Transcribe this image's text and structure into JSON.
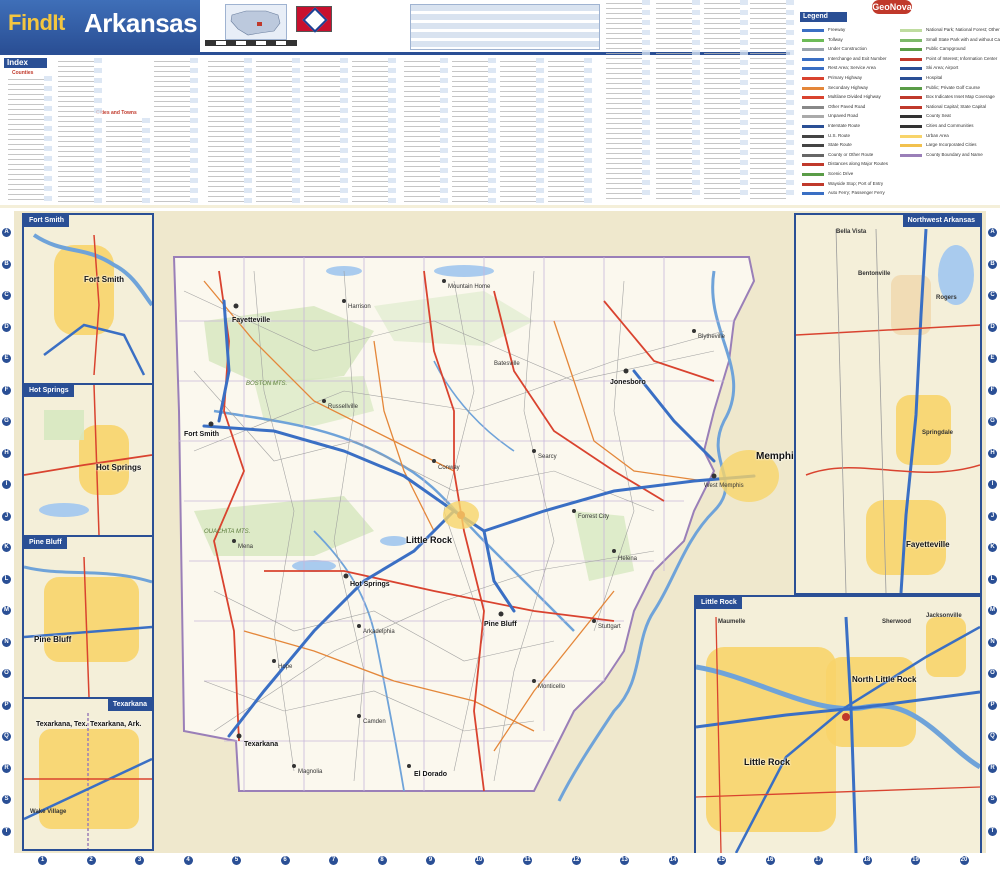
{
  "header": {
    "brand_prefix": "FindIt",
    "state_name": "Arkansas",
    "publisher": "GeoNova"
  },
  "index": {
    "label": "Index",
    "counties_label": "Counties",
    "cities_label": "Cities and Towns"
  },
  "legend": {
    "label": "Legend",
    "items": [
      {
        "label": "Freeway",
        "color": "#3a6fc4"
      },
      {
        "label": "Tollway",
        "color": "#6dbb58"
      },
      {
        "label": "Under Construction",
        "color": "#9aa3ad"
      },
      {
        "label": "Interchange and Exit Number",
        "color": "#3a6fc4"
      },
      {
        "label": "Rest Area; Service Area",
        "color": "#3a6fc4"
      },
      {
        "label": "Primary Highway",
        "color": "#d9432f"
      },
      {
        "label": "Secondary Highway",
        "color": "#e4873a"
      },
      {
        "label": "Multilane Divided Highway",
        "color": "#d9432f"
      },
      {
        "label": "Other Paved Road",
        "color": "#888888"
      },
      {
        "label": "Unpaved Road",
        "color": "#aaaaaa"
      },
      {
        "label": "Interstate Route",
        "color": "#2a4f95"
      },
      {
        "label": "U.S. Route",
        "color": "#444444"
      },
      {
        "label": "State Route",
        "color": "#444444"
      },
      {
        "label": "County or Other Route",
        "color": "#666666"
      },
      {
        "label": "Distances along Major Routes",
        "color": "#c0392b"
      },
      {
        "label": "Scenic Drive",
        "color": "#5a9c47"
      },
      {
        "label": "Wayside Stop; Port of Entry",
        "color": "#c0392b"
      },
      {
        "label": "Auto Ferry; Passenger Ferry",
        "color": "#3a6fc4"
      }
    ],
    "items_right": [
      {
        "label": "National Park; National Forest; Other Large Park",
        "color": "#bfdca0"
      },
      {
        "label": "Small State Park with and without Camping",
        "color": "#7cb96a"
      },
      {
        "label": "Public Campground",
        "color": "#5a9c47"
      },
      {
        "label": "Point of Interest; Information Center",
        "color": "#c0392b"
      },
      {
        "label": "Ski Area; Airport",
        "color": "#2a4f95"
      },
      {
        "label": "Hospital",
        "color": "#2a4f95"
      },
      {
        "label": "Public; Private Golf Course",
        "color": "#5a9c47"
      },
      {
        "label": "Box Indicates Inset Map Coverage",
        "color": "#c0392b"
      },
      {
        "label": "National Capital; State Capital",
        "color": "#c0392b"
      },
      {
        "label": "County Seat",
        "color": "#333333"
      },
      {
        "label": "Cities and Communities",
        "color": "#333333"
      },
      {
        "label": "Urban Area",
        "color": "#f8d46a"
      },
      {
        "label": "Large Incorporated Cities",
        "color": "#f2c14e"
      },
      {
        "label": "County Boundary and Name",
        "color": "#9a7fb8"
      }
    ]
  },
  "insets": {
    "fort_smith": {
      "title": "Fort Smith",
      "city": "Fort Smith"
    },
    "hot_springs": {
      "title": "Hot Springs",
      "city": "Hot Springs"
    },
    "pine_bluff": {
      "title": "Pine Bluff",
      "city": "Pine Bluff"
    },
    "texarkana": {
      "title": "Texarkana",
      "city_ar": "Texarkana, Ark.",
      "city_tx": "Texarkana, Tex.",
      "wake_village": "Wake Village"
    },
    "northwest": {
      "title": "Northwest Arkansas",
      "bella_vista": "Bella Vista",
      "bentonville": "Bentonville",
      "rogers": "Rogers",
      "springdale": "Springdale",
      "fayetteville": "Fayetteville"
    },
    "little_rock": {
      "title": "Little Rock",
      "city": "Little Rock",
      "north": "North Little Rock",
      "jacksonville": "Jacksonville",
      "sherwood": "Sherwood",
      "maumelle": "Maumelle"
    }
  },
  "map": {
    "cities": {
      "little_rock": "Little Rock",
      "fort_smith": "Fort Smith",
      "fayetteville": "Fayetteville",
      "jonesboro": "Jonesboro",
      "memphis": "Memphis",
      "pine_bluff": "Pine Bluff",
      "hot_springs": "Hot Springs",
      "texarkana": "Texarkana",
      "el_dorado": "El Dorado",
      "conway": "Conway",
      "west_memphis": "West Memphis",
      "helena": "Helena",
      "arkadelphia": "Arkadelphia",
      "searcy": "Searcy",
      "russellville": "Russellville",
      "harrison": "Harrison",
      "mountain_home": "Mountain Home",
      "blytheville": "Blytheville",
      "camden": "Camden",
      "magnolia": "Magnolia",
      "hope": "Hope",
      "mena": "Mena",
      "batesville": "Batesville",
      "forrest_city": "Forrest City",
      "stuttgart": "Stuttgart",
      "monticello": "Monticello"
    },
    "regions": {
      "boston_mts": "BOSTON MTS.",
      "ouachita_mts": "OUACHITA MTS."
    },
    "grid_columns": [
      "1",
      "2",
      "3",
      "4",
      "5",
      "6",
      "7",
      "8",
      "9",
      "10",
      "11",
      "12",
      "13",
      "14",
      "15",
      "16",
      "17",
      "18",
      "19",
      "20"
    ],
    "grid_rows": [
      "A",
      "B",
      "C",
      "D",
      "E",
      "F",
      "G",
      "H",
      "I",
      "J",
      "K",
      "L",
      "M",
      "N",
      "O",
      "P",
      "Q",
      "R",
      "S",
      "T"
    ]
  }
}
